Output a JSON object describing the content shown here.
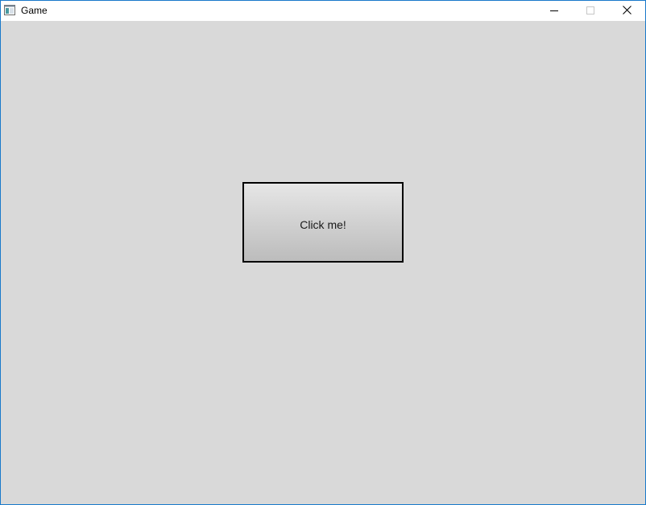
{
  "window": {
    "title": "Game",
    "border_color": "#1979ca",
    "background_color": "#d9d9d9"
  },
  "titlebar": {
    "app_icon": "window-icon",
    "controls": [
      {
        "name": "minimize",
        "icon": "minimize-icon"
      },
      {
        "name": "maximize",
        "icon": "maximize-icon",
        "state": "disabled"
      },
      {
        "name": "close",
        "icon": "close-icon"
      }
    ]
  },
  "game": {
    "button_label": "Click me!"
  }
}
